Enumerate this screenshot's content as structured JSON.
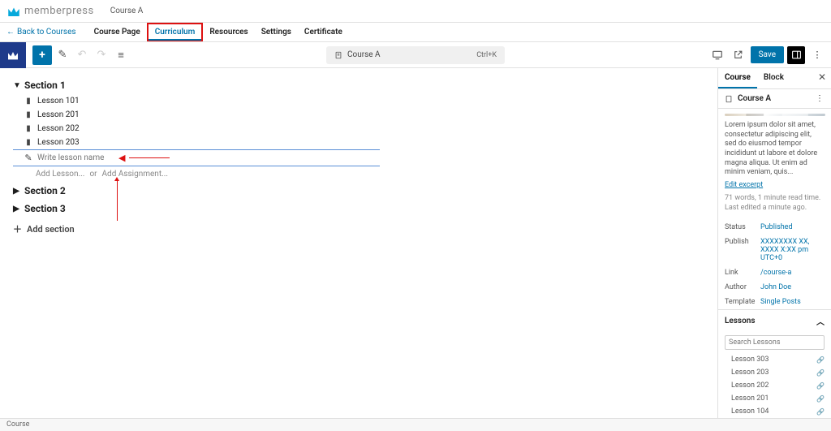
{
  "header": {
    "brand": "memberpress",
    "course_name": "Course A",
    "back_label": "Back to Courses",
    "tabs": [
      "Course Page",
      "Curriculum",
      "Resources",
      "Settings",
      "Certificate"
    ],
    "active_tab": "Curriculum"
  },
  "toolbar": {
    "doc_title": "Course A",
    "shortcut": "Ctrl+K",
    "save_label": "Save"
  },
  "editor": {
    "sections": [
      {
        "title": "Section 1",
        "expanded": true,
        "lessons": [
          "Lesson 101",
          "Lesson 201",
          "Lesson 202",
          "Lesson 203"
        ]
      },
      {
        "title": "Section 2",
        "expanded": false
      },
      {
        "title": "Section 3",
        "expanded": false
      }
    ],
    "new_lesson_placeholder": "Write lesson name",
    "add_lesson_label": "Add Lesson...",
    "or_label": "or",
    "add_assignment_label": "Add Assignment...",
    "add_section_label": "Add section"
  },
  "sidebar": {
    "tabs": [
      "Course",
      "Block"
    ],
    "active_tab": "Course",
    "course_title": "Course A",
    "description": "Lorem ipsum dolor sit amet, consectetur adipiscing elit, sed do eiusmod tempor incididunt ut labore et dolore magna aliqua. Ut enim ad minim veniam, quis...",
    "edit_excerpt": "Edit excerpt",
    "word_meta": "71 words, 1 minute read time.",
    "last_edited": "Last edited a minute ago.",
    "kv": {
      "status_k": "Status",
      "status_v": "Published",
      "publish_k": "Publish",
      "publish_v": "XXXXXXXX XX, XXXX X:XX pm UTC+0",
      "link_k": "Link",
      "link_v": "/course-a",
      "author_k": "Author",
      "author_v": "John Doe",
      "template_k": "Template",
      "template_v": "Single Posts"
    },
    "lessons_panel": "Lessons",
    "search_placeholder": "Search Lessons",
    "lesson_list": [
      "Lesson 303",
      "Lesson 203",
      "Lesson 202",
      "Lesson 201",
      "Lesson 104"
    ]
  },
  "footer": {
    "breadcrumb": "Course"
  }
}
